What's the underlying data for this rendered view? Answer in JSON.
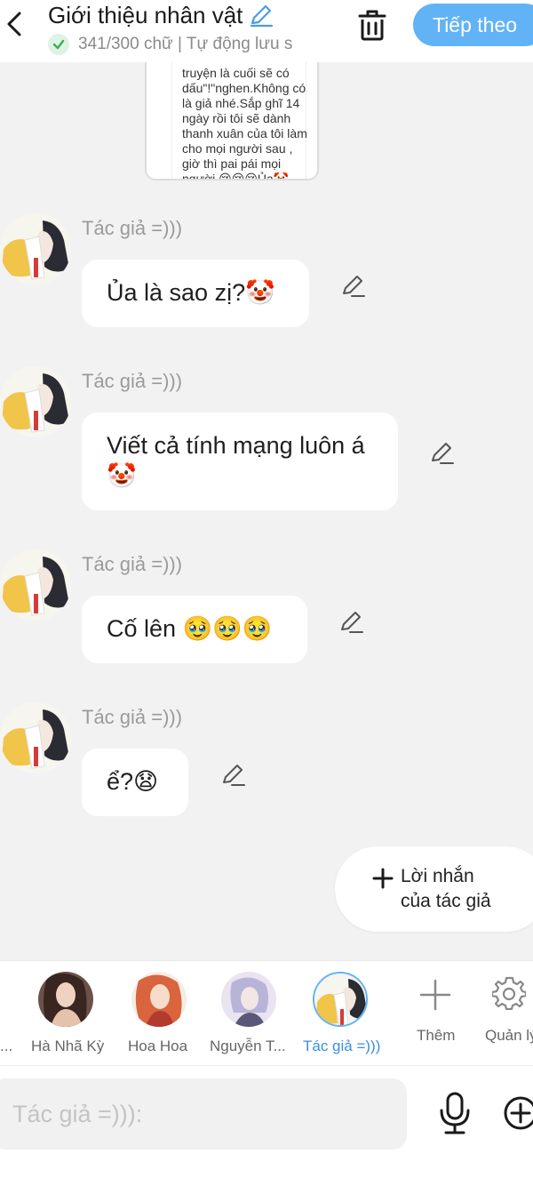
{
  "header": {
    "title": "Giới thiệu nhân vật",
    "subtitle": "341/300 chữ | Tự động lưu s",
    "next_label": "Tiếp theo"
  },
  "preview_card": {
    "text": "truyện là cuối sẽ có dấu\"!\"nghen.Không có là giả nhé.Sắp ghĩ 14 ngày rồi tôi sẽ dành thanh xuân của tôi làm cho mọi người sau , giờ thì pai pái mọi người 😢😢😢Ủa🤡"
  },
  "messages": [
    {
      "author": "Tác giả =)))",
      "text": "Ủa là sao zị?🤡"
    },
    {
      "author": "Tác giả =)))",
      "text": "Viết cả tính mạng luôn á🤡"
    },
    {
      "author": "Tác giả =)))",
      "text": "Cố lên 🥹🥹🥹"
    },
    {
      "author": "Tác giả =)))",
      "text": "ể?😧"
    }
  ],
  "author_note_button": {
    "line1": "Lời nhắn",
    "line2": "của tác giả"
  },
  "characters": [
    {
      "name": "...",
      "active": false
    },
    {
      "name": "Hà Nhã Kỳ",
      "active": false
    },
    {
      "name": "Hoa Hoa",
      "active": false
    },
    {
      "name": "Nguyễn T...",
      "active": false
    },
    {
      "name": "Tác giả =)))",
      "active": true
    }
  ],
  "char_actions": {
    "add_label": "Thêm",
    "manage_label": "Quản lý"
  },
  "input": {
    "placeholder": "Tác giả =))):"
  },
  "colors": {
    "accent": "#62b3f6",
    "active_label": "#3a8fe0",
    "check_green": "#3fae5a",
    "background": "#f2f2f2"
  }
}
